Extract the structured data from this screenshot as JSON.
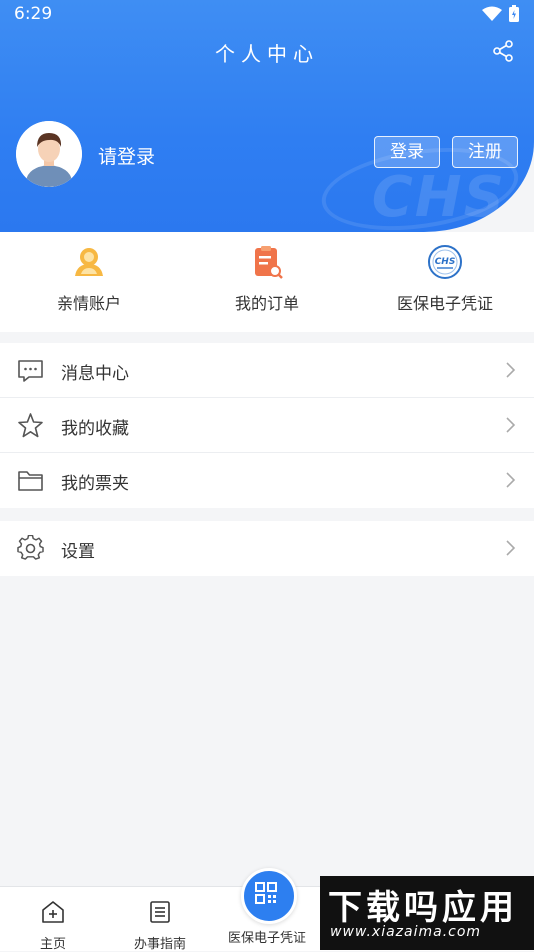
{
  "status_bar": {
    "time": "6:29"
  },
  "header": {
    "title": "个人中心",
    "login_prompt": "请登录",
    "login_button": "登录",
    "register_button": "注册",
    "watermark_text": "CHS",
    "background_color": "#3080F0"
  },
  "quick_actions": [
    {
      "label": "亲情账户",
      "icon": "family-account-icon"
    },
    {
      "label": "我的订单",
      "icon": "order-icon"
    },
    {
      "label": "医保电子凭证",
      "icon": "chs-badge-icon"
    }
  ],
  "menu": {
    "group1": [
      {
        "label": "消息中心",
        "icon": "message-icon"
      },
      {
        "label": "我的收藏",
        "icon": "star-icon"
      },
      {
        "label": "我的票夹",
        "icon": "folder-icon"
      }
    ],
    "group2": [
      {
        "label": "设置",
        "icon": "gear-icon"
      }
    ]
  },
  "tabbar": {
    "home": "主页",
    "guide": "办事指南",
    "center": "医保电子凭证"
  },
  "corner_watermark": {
    "big": "下载吗应用",
    "small": "www.xiazaima.com"
  }
}
